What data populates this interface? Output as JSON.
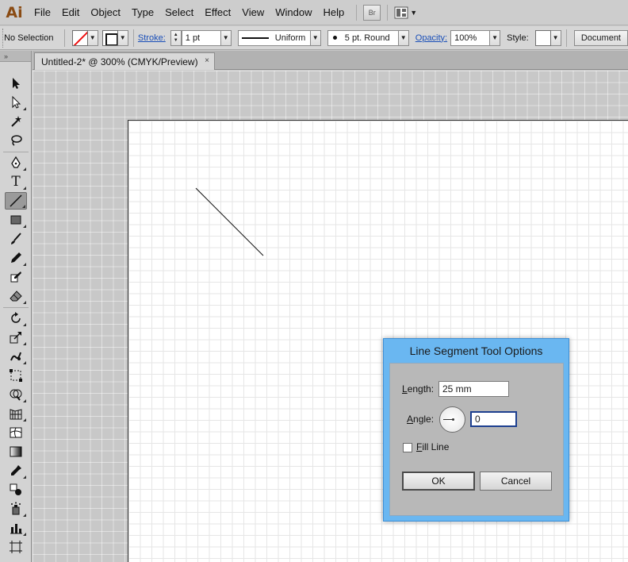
{
  "app": {
    "logo": "Ai",
    "menus": [
      "File",
      "Edit",
      "Object",
      "Type",
      "Select",
      "Effect",
      "View",
      "Window",
      "Help"
    ],
    "bridge_label": "Br"
  },
  "control_bar": {
    "selection_status": "No Selection",
    "stroke_label": "Stroke:",
    "stroke_weight": "1 pt",
    "profile_label": "Uniform",
    "brush_label": "5 pt. Round",
    "opacity_label": "Opacity:",
    "opacity_value": "100%",
    "style_label": "Style:",
    "document_button": "Document"
  },
  "document": {
    "tab_title": "Untitled-2* @ 300% (CMYK/Preview)",
    "close_glyph": "×"
  },
  "tools": [
    {
      "name": "selection-tool-icon"
    },
    {
      "name": "direct-selection-tool-icon"
    },
    {
      "name": "magic-wand-tool-icon"
    },
    {
      "name": "lasso-tool-icon"
    },
    {
      "name": "pen-tool-icon"
    },
    {
      "name": "type-tool-icon",
      "glyph": "T"
    },
    {
      "name": "line-segment-tool-icon",
      "active": true
    },
    {
      "name": "rectangle-tool-icon"
    },
    {
      "name": "paintbrush-tool-icon"
    },
    {
      "name": "pencil-tool-icon"
    },
    {
      "name": "blob-brush-tool-icon"
    },
    {
      "name": "eraser-tool-icon"
    },
    {
      "name": "rotate-tool-icon"
    },
    {
      "name": "scale-tool-icon"
    },
    {
      "name": "warp-tool-icon"
    },
    {
      "name": "free-transform-tool-icon"
    },
    {
      "name": "shape-builder-tool-icon"
    },
    {
      "name": "perspective-grid-tool-icon"
    },
    {
      "name": "mesh-tool-icon"
    },
    {
      "name": "gradient-tool-icon"
    },
    {
      "name": "eyedropper-tool-icon"
    },
    {
      "name": "blend-tool-icon"
    },
    {
      "name": "symbol-sprayer-tool-icon"
    },
    {
      "name": "column-graph-tool-icon"
    },
    {
      "name": "artboard-tool-icon"
    }
  ],
  "dialog": {
    "title": "Line Segment Tool Options",
    "length_label_u": "L",
    "length_label_rest": "ength:",
    "length_value": "25 mm",
    "angle_label_u": "A",
    "angle_label_rest": "ngle:",
    "angle_value": "0",
    "fill_line_label_u": "F",
    "fill_line_label_rest": "ill Line",
    "fill_line_checked": false,
    "ok_label": "OK",
    "cancel_label": "Cancel"
  },
  "colors": {
    "dialog_title_bar": "#6ab7f1",
    "logo": "#8a4b13",
    "link_blue": "#1a4fb8",
    "no_fill_red": "#e11111"
  }
}
